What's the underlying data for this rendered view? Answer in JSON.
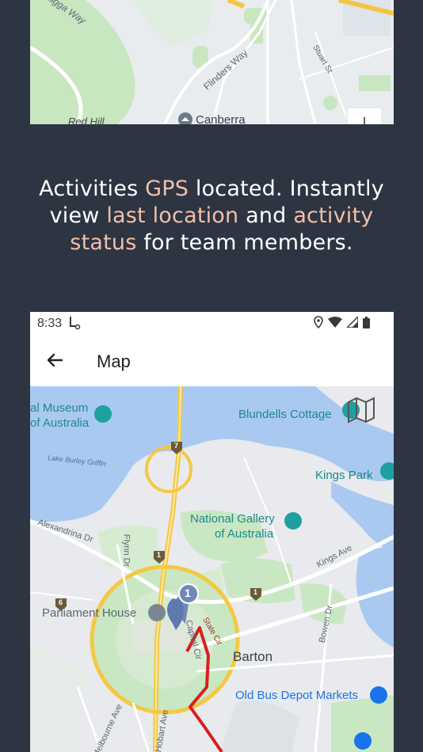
{
  "top_map": {
    "labels": {
      "road1": "agga Way",
      "road2": "Flinders Way",
      "road3": "Stuart St",
      "place1": "Red Hill",
      "place2": "Canberra"
    }
  },
  "headline": {
    "p1": "Activities ",
    "h1": "GPS",
    "p2": " located. Instantly view ",
    "h2": "last location",
    "p3": " and ",
    "h3": "activity status",
    "p4": " for team members."
  },
  "status_bar": {
    "time": "8:33"
  },
  "app_bar": {
    "title": "Map"
  },
  "map": {
    "labels": {
      "museum": "al Museum\nof Australia",
      "museum_l1": "al Museum",
      "museum_l2": "of Australia",
      "blundells": "Blundells Cottage",
      "lake": "Lake Burley Griffin",
      "kings_park": "Kings Park",
      "gallery_l1": "National Gallery",
      "gallery_l2": "of Australia",
      "alexandrina": "Alexandrina Dr",
      "flynn": "Flynn Dr",
      "kings_ave": "Kings Ave",
      "parliament": "Parliament House",
      "state_cir": "State Cir",
      "capital_cir": "Capital Cir",
      "barton": "Barton",
      "bowen": "Bowen Dr",
      "old_bus": "Old Bus Depot Markets",
      "melbourne": "Melbourne Ave",
      "hobart": "Hobart Ave",
      "route_7": "7",
      "route_1a": "1",
      "route_1b": "1",
      "route_6": "6",
      "marker_count": "1"
    }
  },
  "colors": {
    "background": "#2d3442",
    "highlight": "#f2bfa9",
    "water": "#aac9f1",
    "park": "#c9e7c3",
    "route": "#d71f1f",
    "poi_teal": "#1fa0a0",
    "poi_blue": "#1a73e8"
  }
}
